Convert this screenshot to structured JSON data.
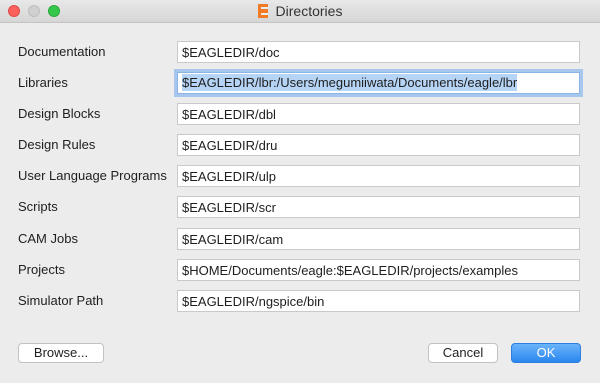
{
  "window": {
    "title": "Directories"
  },
  "rows": [
    {
      "label": "Documentation",
      "value": "$EAGLEDIR/doc"
    },
    {
      "label": "Libraries",
      "value": "$EAGLEDIR/lbr:/Users/megumiiwata/Documents/eagle/lbr"
    },
    {
      "label": "Design Blocks",
      "value": "$EAGLEDIR/dbl"
    },
    {
      "label": "Design Rules",
      "value": "$EAGLEDIR/dru"
    },
    {
      "label": "User Language Programs",
      "value": "$EAGLEDIR/ulp"
    },
    {
      "label": "Scripts",
      "value": "$EAGLEDIR/scr"
    },
    {
      "label": "CAM Jobs",
      "value": "$EAGLEDIR/cam"
    },
    {
      "label": "Projects",
      "value": "$HOME/Documents/eagle:$EAGLEDIR/projects/examples"
    },
    {
      "label": "Simulator Path",
      "value": "$EAGLEDIR/ngspice/bin"
    }
  ],
  "buttons": {
    "browse": "Browse...",
    "cancel": "Cancel",
    "ok": "OK"
  },
  "colors": {
    "accent": "#2a87f0",
    "focus_ring": "#a7c7ef",
    "close": "#fc605c",
    "maximize": "#34c84a",
    "app_icon": "#f07a26"
  },
  "icons": {
    "app": "eagle-e-icon"
  }
}
